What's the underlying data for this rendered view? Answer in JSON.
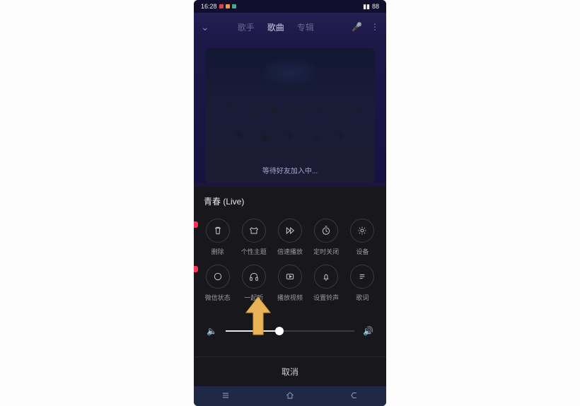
{
  "status": {
    "time": "16:28",
    "battery": "88"
  },
  "header": {
    "tabs": [
      "歌手",
      "歌曲",
      "专辑"
    ],
    "active_tab_index": 1
  },
  "cover": {
    "caption": "等待好友加入中..."
  },
  "sheet": {
    "title": "青春 (Live)",
    "row1": [
      {
        "icon": "trash-icon",
        "label": "删除"
      },
      {
        "icon": "tshirt-icon",
        "label": "个性主题"
      },
      {
        "icon": "speed-icon",
        "label": "倍速播放"
      },
      {
        "icon": "timer-icon",
        "label": "定时关闭"
      },
      {
        "icon": "settings-icon",
        "label": "设备"
      }
    ],
    "row2": [
      {
        "icon": "circle-icon",
        "label": "微信状态"
      },
      {
        "icon": "headphones-icon",
        "label": "一起听"
      },
      {
        "icon": "video-icon",
        "label": "播放视频"
      },
      {
        "icon": "bell-icon",
        "label": "设置铃声"
      },
      {
        "icon": "lyrics-icon",
        "label": "歌词"
      }
    ],
    "volume_percent": 42,
    "cancel_label": "取消"
  }
}
